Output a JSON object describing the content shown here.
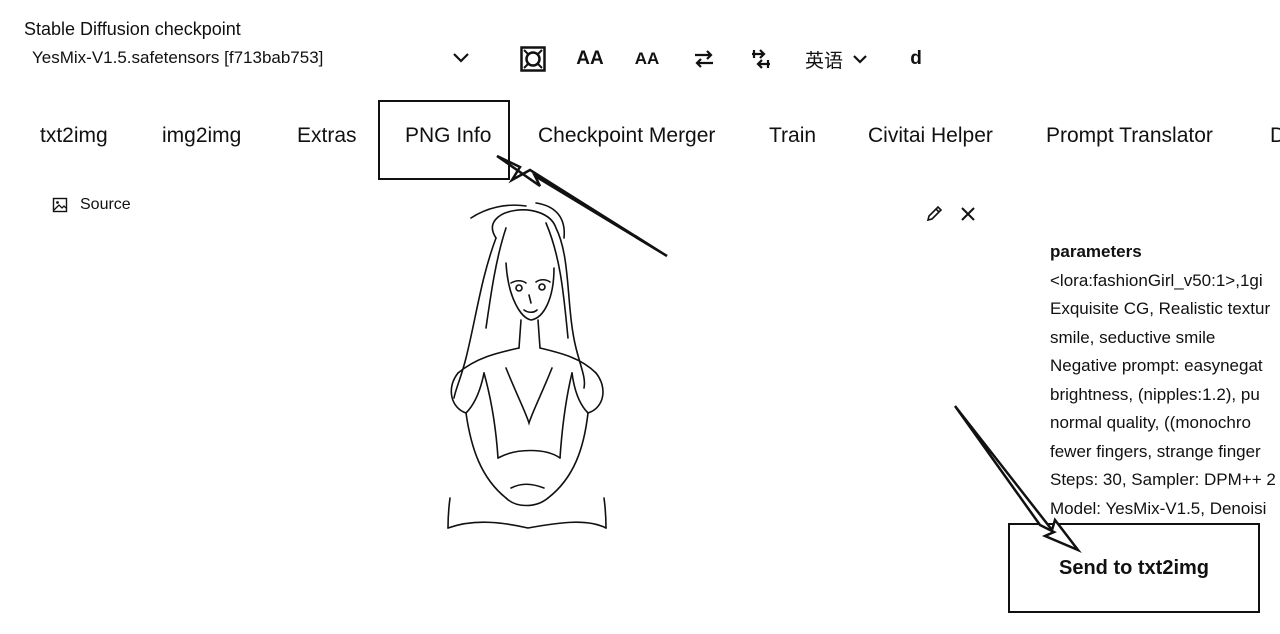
{
  "checkpoint": {
    "label": "Stable Diffusion checkpoint",
    "value": "YesMix-V1.5.safetensors [f713bab753]"
  },
  "toolbar": {
    "icons": [
      "refresh-icon",
      "font-size-icon",
      "font-size-small-icon",
      "swap-icon",
      "arrange-icon"
    ],
    "aa_large": "AA",
    "aa_small": "AA",
    "language": "英语",
    "extra": "d"
  },
  "tabs": [
    {
      "label": "txt2img"
    },
    {
      "label": "img2img"
    },
    {
      "label": "Extras"
    },
    {
      "label": "PNG Info",
      "selected": true
    },
    {
      "label": "Checkpoint Merger"
    },
    {
      "label": "Train"
    },
    {
      "label": "Civitai Helper"
    },
    {
      "label": "Prompt Translator"
    },
    {
      "label": "D"
    }
  ],
  "source": {
    "label": "Source"
  },
  "parameters": {
    "title": "parameters",
    "lines": [
      "<lora:fashionGirl_v50:1>,1gi",
      "Exquisite CG, Realistic textur",
      "smile, seductive smile",
      "Negative prompt: easynegat",
      "brightness, (nipples:1.2), pu",
      "normal quality, ((monochro",
      "fewer fingers, strange finger",
      "Steps: 30, Sampler: DPM++ 2",
      "Model: YesMix-V1.5, Denoisi"
    ]
  },
  "send_button": {
    "label": "Send to txt2img"
  }
}
